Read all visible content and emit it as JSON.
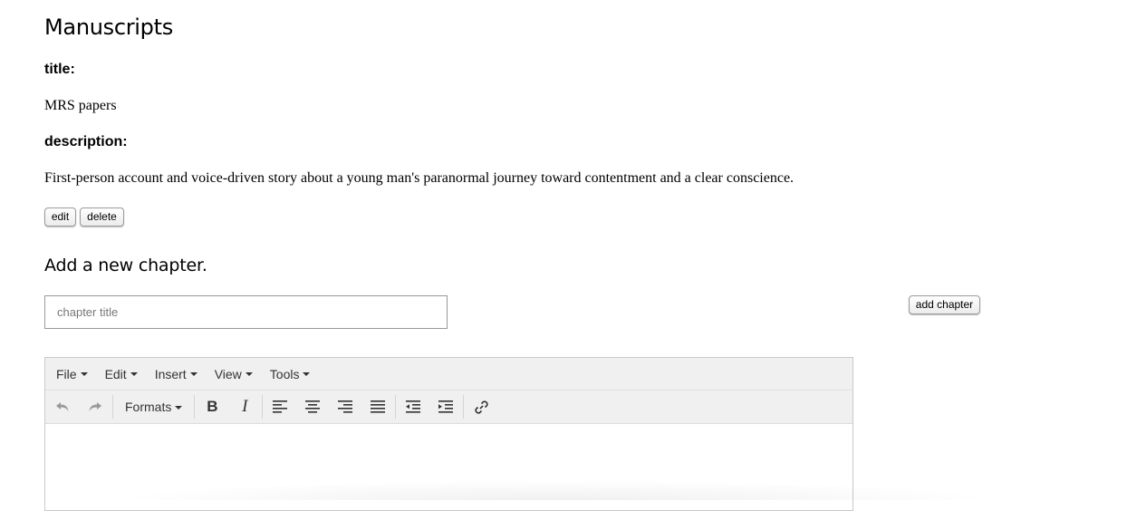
{
  "page": {
    "title": "Manuscripts"
  },
  "manuscript": {
    "title_label": "title:",
    "title_value": "MRS papers",
    "description_label": "description:",
    "description_value": "First-person account and voice-driven story about a young man's paranormal journey toward contentment and a clear conscience."
  },
  "actions": {
    "edit_label": "edit",
    "delete_label": "delete"
  },
  "new_chapter": {
    "heading": "Add a new chapter.",
    "input_placeholder": "chapter title",
    "input_value": "",
    "add_button_label": "add chapter"
  },
  "editor": {
    "menu": [
      "File",
      "Edit",
      "Insert",
      "View",
      "Tools"
    ],
    "formats_label": "Formats",
    "toolbar_icons": [
      "undo-icon",
      "redo-icon",
      "bold-icon",
      "italic-icon",
      "align-left-icon",
      "align-center-icon",
      "align-right-icon",
      "align-justify-icon",
      "outdent-icon",
      "indent-icon",
      "link-icon"
    ],
    "bold_glyph": "B",
    "italic_glyph": "I",
    "content": ""
  }
}
